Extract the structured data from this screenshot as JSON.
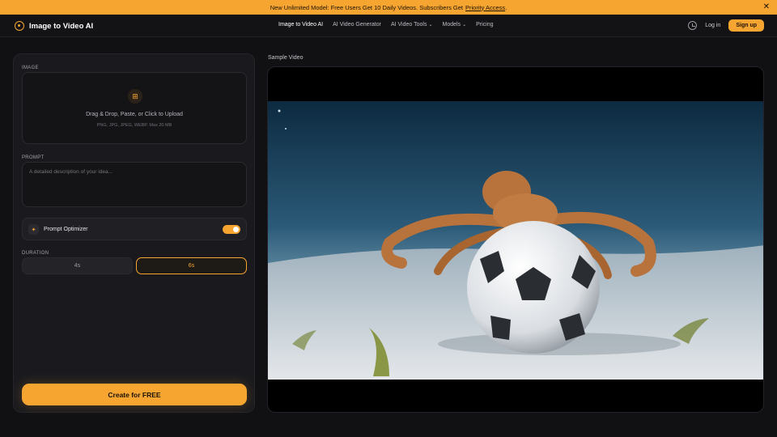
{
  "banner": {
    "text": "New Unlimited Model: Free Users Get 10 Daily Videos. Subscribers Get",
    "link": "Priority Access",
    "suffix": ".",
    "close_icon": "close-icon"
  },
  "nav": {
    "logo": "Image to Video AI",
    "items": [
      "Image to Video AI",
      "AI Video Generator",
      "AI Video Tools",
      "Models",
      "Pricing"
    ],
    "login": "Log in",
    "signup": "Sign up"
  },
  "form": {
    "image_label": "IMAGE",
    "upload_text": "Drag & Drop, Paste, or Click to Upload",
    "upload_sub": "PNG, JPG, JPEG, WEBP. Max 20 MB",
    "prompt_label": "PROMPT",
    "prompt_placeholder": "A detailed description of your idea...",
    "optimizer_label": "Prompt Optimizer",
    "optimizer_on": true,
    "duration_label": "DURATION",
    "durations": [
      "4s",
      "6s"
    ],
    "selected_duration": "6s",
    "create_label": "Create for FREE"
  },
  "preview": {
    "label": "Sample Video"
  },
  "colors": {
    "accent": "#f7a531",
    "background": "#111114",
    "panel": "#1a1a1e"
  }
}
